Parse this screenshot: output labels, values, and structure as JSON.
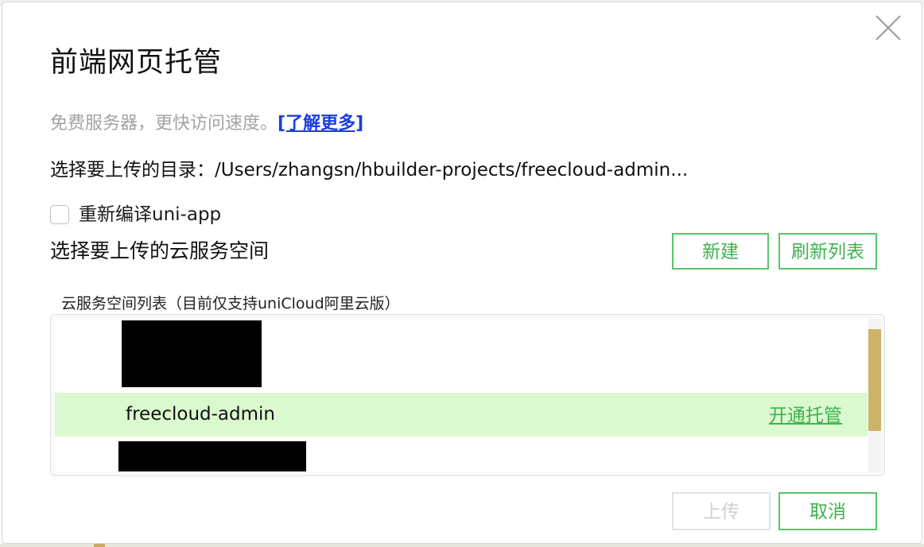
{
  "dialog": {
    "title": "前端网页托管",
    "close_icon": "close-icon"
  },
  "intro": {
    "text": "免费服务器，更快访问速度。",
    "link": "[了解更多]"
  },
  "directory": {
    "label": "选择要上传的目录：",
    "path": "/Users/zhangsn/hbuilder-projects/freecloud-admin..."
  },
  "recompile": {
    "label": "重新编译uni-app",
    "checked": false
  },
  "space": {
    "label": "选择要上传的云服务空间",
    "new_button": "新建",
    "refresh_button": "刷新列表",
    "list_caption": "云服务空间列表（目前仅支持uniCloud阿里云版）",
    "items": [
      {
        "name": "",
        "redacted": true
      },
      {
        "name": "freecloud-admin",
        "action": "开通托管",
        "selected": true
      },
      {
        "name": "",
        "redacted": true
      }
    ]
  },
  "footer": {
    "upload_button": "上传",
    "upload_enabled": false,
    "cancel_button": "取消"
  },
  "colors": {
    "accent": "#3fb24f",
    "selected_row": "#dbf9cf",
    "link": "#1a3ce8",
    "scroll_thumb": "#cdb368"
  }
}
